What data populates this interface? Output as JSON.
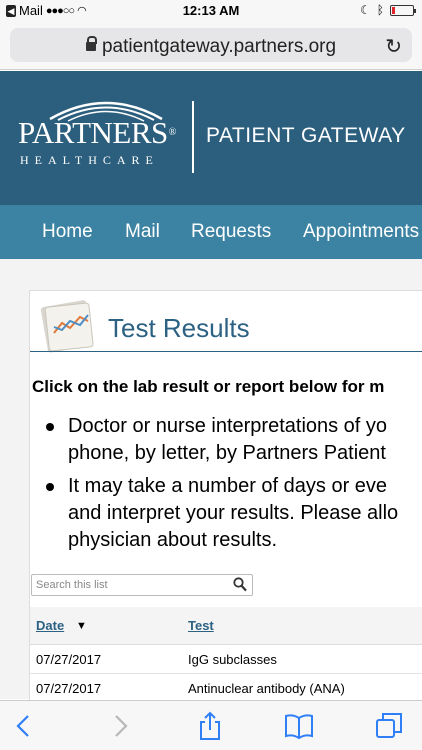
{
  "status_bar": {
    "app_back": "Mail",
    "time": "12:13 AM",
    "battery_level": 0.15
  },
  "browser": {
    "url": "patientgateway.partners.org"
  },
  "header": {
    "logo_name": "PARTNERS",
    "logo_reg": "®",
    "logo_sub": "HEALTHCARE",
    "title": "PATIENT GATEWAY"
  },
  "nav": {
    "items": [
      {
        "label": "Home"
      },
      {
        "label": "Mail"
      },
      {
        "label": "Requests"
      },
      {
        "label": "Appointments"
      }
    ]
  },
  "main": {
    "title": "Test Results",
    "intro": "Click on the lab result or report below for m",
    "bullets": [
      {
        "line1": "Doctor or nurse interpretations of yo",
        "line2": "phone, by letter, by Partners Patient"
      },
      {
        "line1": "It may take a number of days or eve",
        "line2": "and interpret your results. Please allo",
        "line3": "physician about results."
      }
    ],
    "search": {
      "placeholder": "Search this list"
    },
    "table": {
      "headers": {
        "date": "Date",
        "sort_indicator": "▼",
        "test": "Test"
      },
      "rows": [
        {
          "date": "07/27/2017",
          "test": "IgG subclasses"
        },
        {
          "date": "07/27/2017",
          "test": "Antinuclear antibody (ANA)"
        }
      ]
    }
  },
  "colors": {
    "banner": "#2c5f7e",
    "nav": "#3c83a3",
    "accent": "#2c6183",
    "ios_blue": "#2f7ff6"
  }
}
